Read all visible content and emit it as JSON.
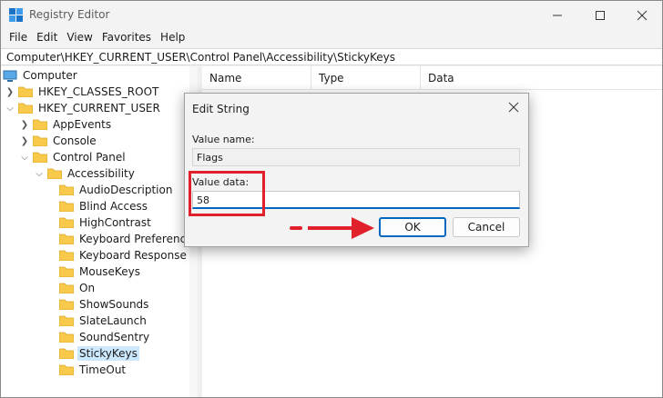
{
  "window": {
    "title": "Registry Editor"
  },
  "menu": [
    "File",
    "Edit",
    "View",
    "Favorites",
    "Help"
  ],
  "address": "Computer\\HKEY_CURRENT_USER\\Control Panel\\Accessibility\\StickyKeys",
  "tree": {
    "root": "Computer",
    "hkcr": "HKEY_CLASSES_ROOT",
    "hkcu": "HKEY_CURRENT_USER",
    "hkcu_children": [
      "AppEvents",
      "Console",
      "Control Panel"
    ],
    "control_panel_child": "Accessibility",
    "accessibility_children": [
      "AudioDescription",
      "Blind Access",
      "HighContrast",
      "Keyboard Preference",
      "Keyboard Response",
      "MouseKeys",
      "On",
      "ShowSounds",
      "SlateLaunch",
      "SoundSentry",
      "StickyKeys",
      "TimeOut"
    ],
    "selected": "StickyKeys"
  },
  "list_headers": [
    "Name",
    "Type",
    "Data"
  ],
  "dialog": {
    "title": "Edit String",
    "value_name_label": "Value name:",
    "value_name": "Flags",
    "value_data_label": "Value data:",
    "value_data": "58",
    "ok_label": "OK",
    "cancel_label": "Cancel"
  },
  "colors": {
    "annotation_red": "#e0202a",
    "ok_border": "#0067c0",
    "folder": "#f8c94b",
    "selection": "#cce8ff"
  }
}
